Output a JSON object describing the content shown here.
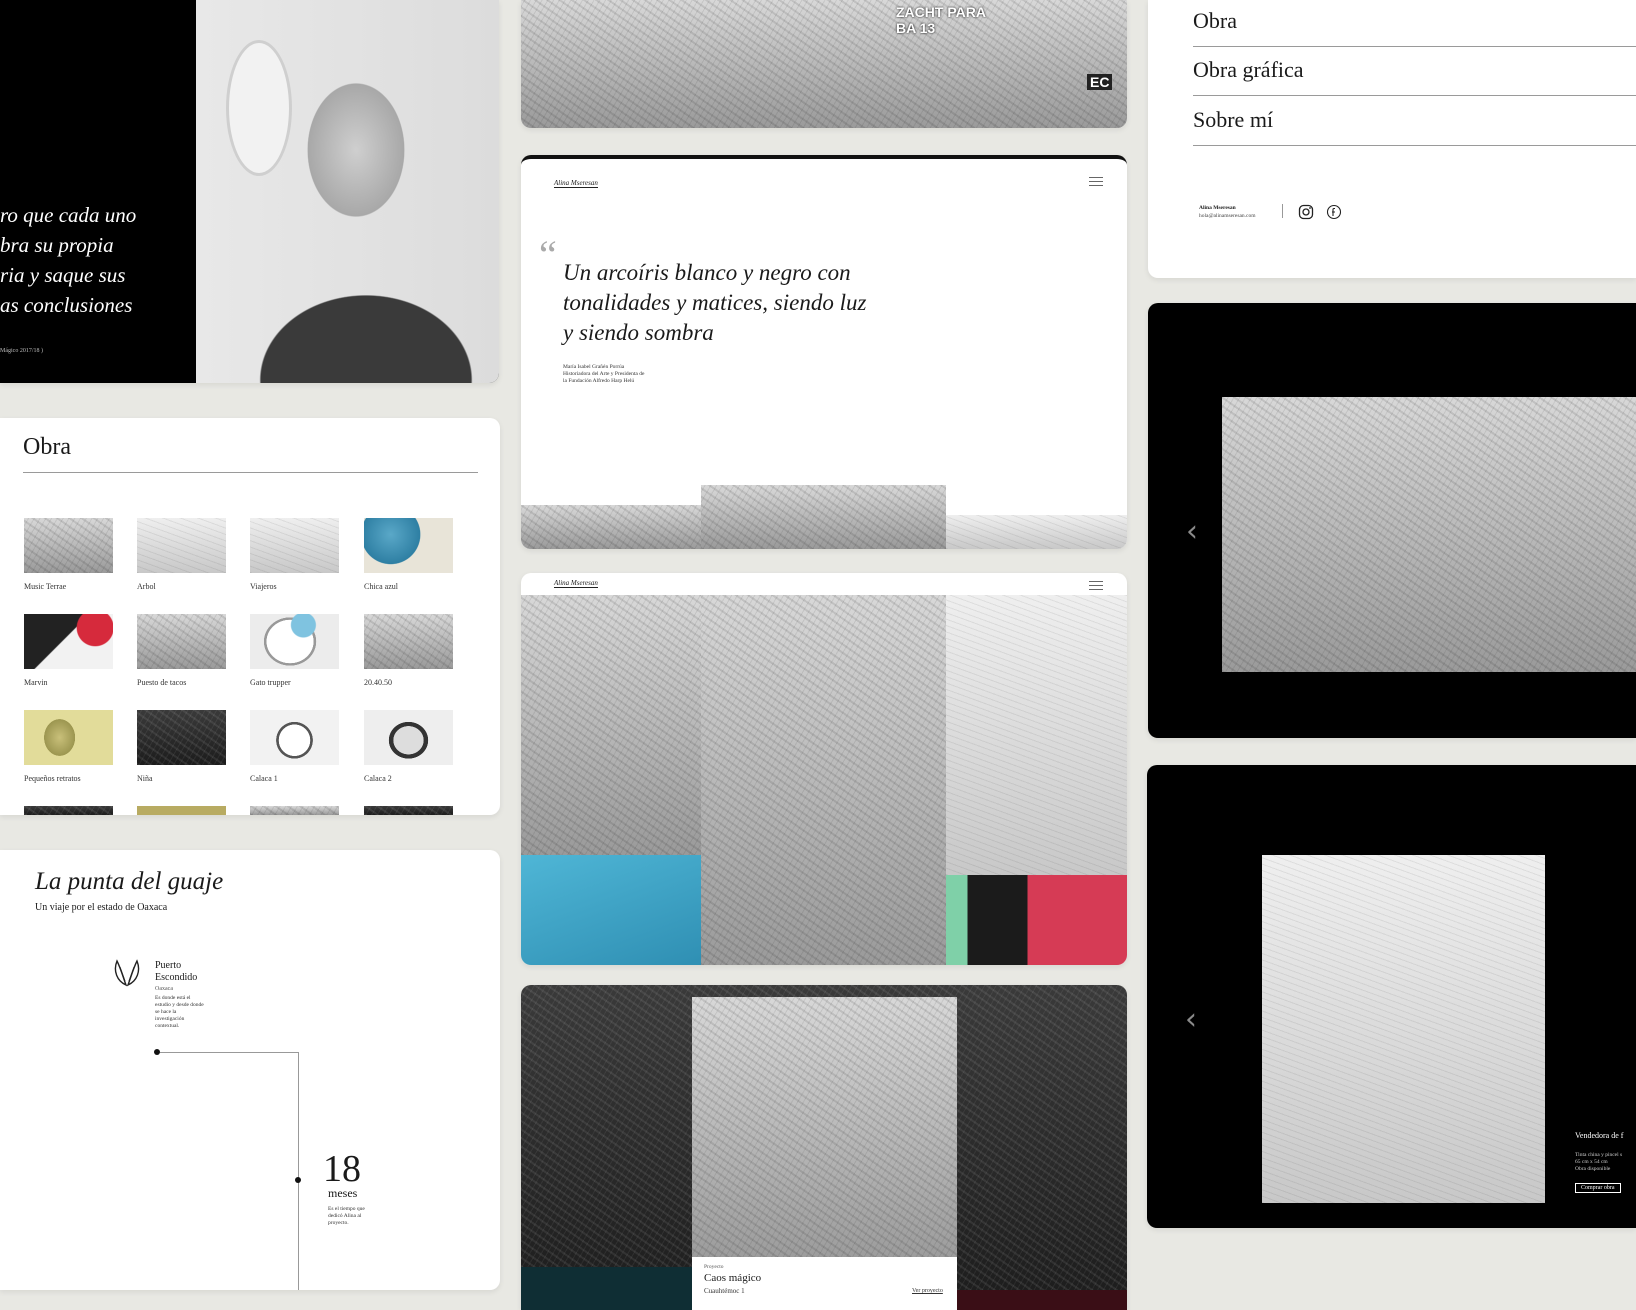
{
  "hero": {
    "quote_lines": [
      "ro que cada uno",
      "bra su propia",
      "ria y saque sus",
      "as conclusiones"
    ],
    "caption": "Mágico 2017/18 )"
  },
  "obra_grid": {
    "title": "Obra",
    "items": [
      {
        "label": "Music Terrae"
      },
      {
        "label": "Arbol"
      },
      {
        "label": "Viajeros"
      },
      {
        "label": "Chica azul"
      },
      {
        "label": "Marvin"
      },
      {
        "label": "Puesto de tacos"
      },
      {
        "label": "Gato trupper"
      },
      {
        "label": "20.40.50"
      },
      {
        "label": "Pequeños retratos"
      },
      {
        "label": "Niña"
      },
      {
        "label": "Calaca 1"
      },
      {
        "label": "Calaca 2"
      }
    ]
  },
  "project": {
    "title": "La punta del guaje",
    "subtitle": "Un viaje por el estado de Oaxaca",
    "place_name": "Puerto Escondido",
    "place_region": "Oaxaca",
    "place_desc": "Es donde está el estudio y desde donde se hace la investigación contextual.",
    "stat_number": "18",
    "stat_unit": "meses",
    "stat_desc": "Es el tiempo que dedicó Alina al proyecto."
  },
  "banner_top": {
    "sign_text": "ZACHT PARA BA 13",
    "badge": "EC"
  },
  "quote_card": {
    "logo": "Alina Mseresan",
    "quote_mark": "“",
    "quote_lines": [
      "Un arcoíris blanco y negro con",
      "tonalidades y matices, siendo luz",
      "y siendo sombra"
    ],
    "author_lines": [
      "María Isabel Grañén Porrúa",
      "Historiadora del Arte y Presidenta de",
      "la Fundación Alfredo Harp Helú"
    ]
  },
  "gallery_card": {
    "logo": "Alina Mseresan"
  },
  "project_overlay": {
    "kicker": "Proyecto",
    "title": "Caos mágico",
    "location": "Cuauhtémoc 1",
    "link": "Ver proyecto"
  },
  "menu": {
    "items": [
      {
        "label": "Obra"
      },
      {
        "label": "Obra gráfica"
      },
      {
        "label": "Sobre mí"
      }
    ],
    "footer_name": "Alina Mseresan",
    "footer_email": "hola@alinamseresan.com",
    "social_icons": [
      "instagram-icon",
      "facebook-icon"
    ]
  },
  "viewer_top": {
    "prev": "‹"
  },
  "viewer_bottom": {
    "prev": "‹",
    "title": "Vendedora de f",
    "details": [
      "Tinta china y pincel s",
      "65 cm x 54 cm",
      "Obra disponible"
    ],
    "button": "Comprar obra"
  }
}
